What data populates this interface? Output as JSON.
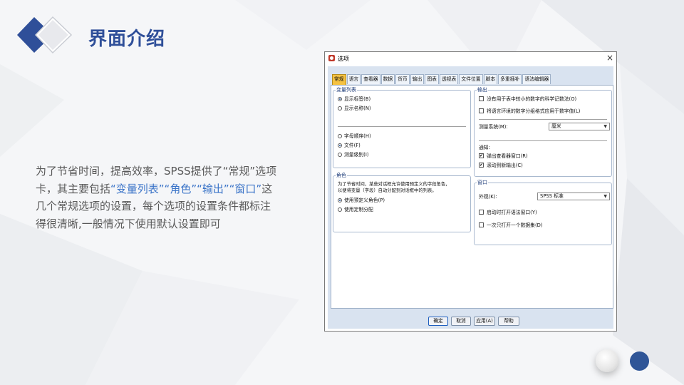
{
  "slide": {
    "title": "界面介绍",
    "desc_parts": [
      {
        "text": "为了节省时间，提高效率，SPSS提供了“常规”选项卡，其主要包括",
        "hl": false
      },
      {
        "text": "“变量列表”“角色”“输出”“窗口”",
        "hl": true
      },
      {
        "text": "这几个常规选项的设置，每个选项的设置条件都标注得很清晰,一般情况下使用默认设置即可",
        "hl": false
      }
    ]
  },
  "dialog": {
    "title": "选项",
    "close_glyph": "×",
    "tabs": [
      "常规",
      "语言",
      "查看器",
      "数据",
      "货币",
      "输出",
      "图表",
      "透视表",
      "文件位置",
      "脚本",
      "多重插补",
      "语法编辑器"
    ],
    "var_list": {
      "title": "变量列表",
      "opt_labels": "显示标签(B)",
      "opt_names": "显示名称(N)",
      "opt_alpha": "字母顺序(H)",
      "opt_file": "文件(F)",
      "opt_measure": "测量级别(I)"
    },
    "role": {
      "title": "角色",
      "desc1": "为了节省时间，某些对话框允许使用预定义的字段角色，",
      "desc2": "以便将变量（字段）自动分配到对话框中的列表。",
      "opt_predefined": "使用预定义角色(P)",
      "opt_custom": "使用定制分配"
    },
    "output": {
      "title": "输出",
      "no_sci": "没有用于表中较小的数字的科学记数法(O)",
      "locale_grouping": "将语言环境的数字分组格式应用于数字值(L)",
      "measure_label": "测量系统(M):",
      "measure_value": "厘米",
      "notify_label": "通知:",
      "popup_viewer": "弹出查看器窗口(R)",
      "scroll_new": "滚动到新输出(C)"
    },
    "window": {
      "title": "窗口",
      "look_label": "外观(K):",
      "look_value": "SPSS 标准",
      "open_syntax": "启动时打开语法窗口(Y)",
      "one_dataset": "一次只打开一个数据集(D)"
    },
    "buttons": {
      "ok": "确定",
      "cancel": "取消",
      "apply": "应用(A)",
      "help": "帮助"
    },
    "state": {
      "active_tab": "常规",
      "show_labels": true,
      "order": "file",
      "role": "predefined",
      "no_sci_checked": false,
      "locale_checked": false,
      "popup_checked": true,
      "scroll_checked": true,
      "open_syntax_checked": false,
      "one_dataset_checked": false
    }
  },
  "colors": {
    "title_blue": "#2f4f99",
    "highlight_blue": "#3b74c8",
    "active_tab": "#f5c242",
    "dialog_frame": "#d9e3f0"
  }
}
